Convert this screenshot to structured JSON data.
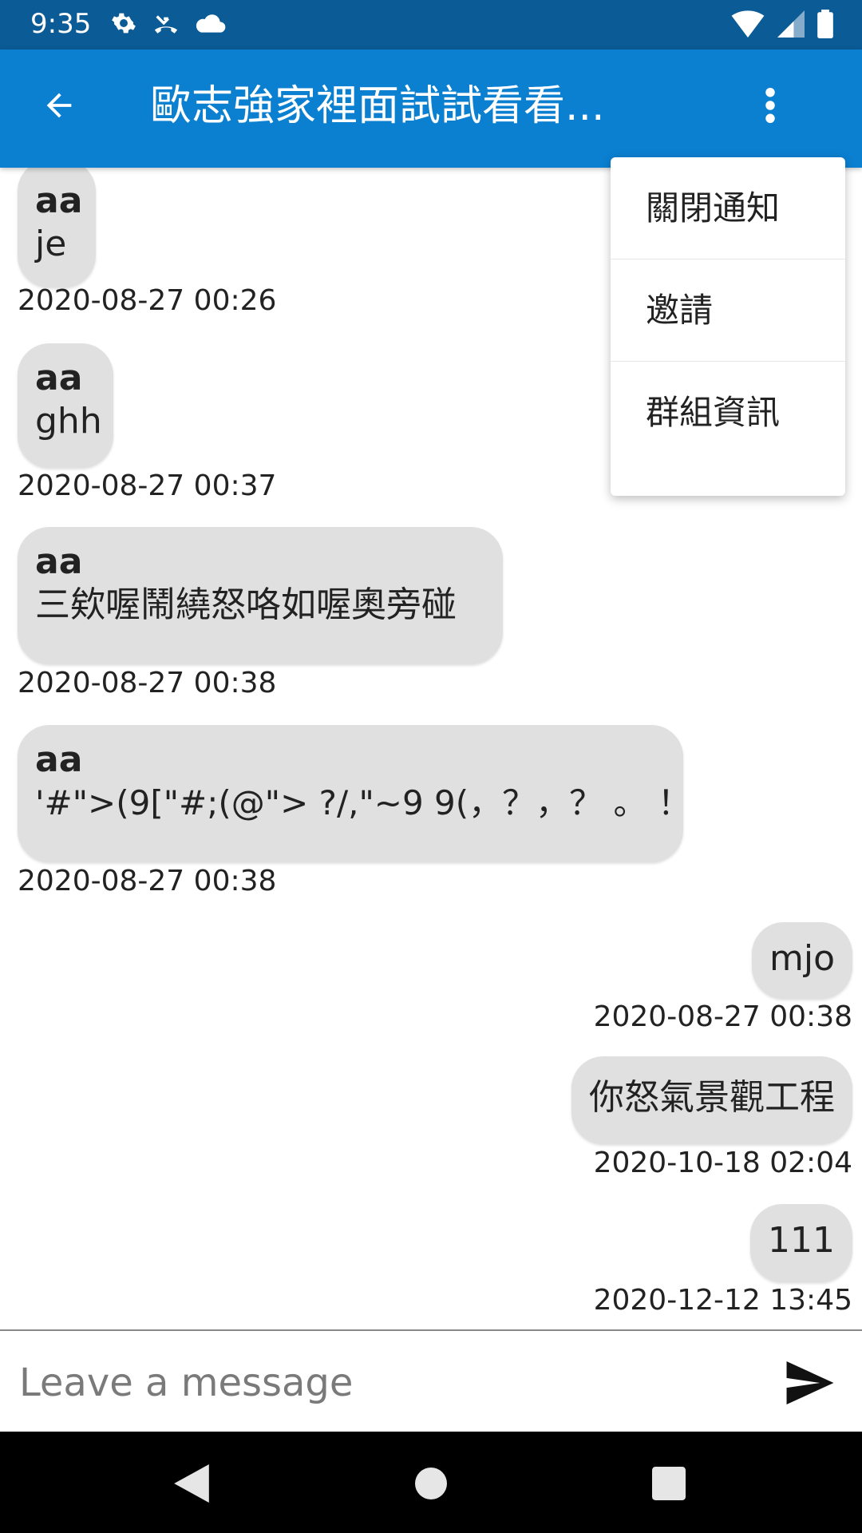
{
  "status_bar": {
    "time": "9:35",
    "icons_left": [
      "gear-icon",
      "missed-call-icon",
      "cloud-icon"
    ],
    "icons_right": [
      "wifi-icon",
      "signal-icon",
      "battery-icon"
    ]
  },
  "app_bar": {
    "title": "歐志強家裡面試試看看...",
    "accent_color": "#0b7fd0"
  },
  "menu": {
    "items": [
      "關閉通知",
      "邀請",
      "群組資訊"
    ]
  },
  "messages": [
    {
      "side": "left",
      "sender": "aa",
      "text": "je",
      "time": "2020-08-27 00:26"
    },
    {
      "side": "left",
      "sender": "aa",
      "text": "ghh",
      "time": "2020-08-27 00:37"
    },
    {
      "side": "left",
      "sender": "aa",
      "text": "三欸喔鬧繞怒咯如喔奧旁碰",
      "time": "2020-08-27 00:38"
    },
    {
      "side": "left",
      "sender": "aa",
      "text": "'#\">(9[\"#;(@\"> ?/,\"~9 9(，？，？ 。 ！",
      "time": "2020-08-27 00:38"
    },
    {
      "side": "right",
      "text": "mjo",
      "time": "2020-08-27 00:38"
    },
    {
      "side": "right",
      "text": "你怒氣景觀工程",
      "time": "2020-10-18 02:04"
    },
    {
      "side": "right",
      "text": "111",
      "time": "2020-12-12 13:45"
    }
  ],
  "composer": {
    "placeholder": "Leave a message",
    "value": ""
  }
}
